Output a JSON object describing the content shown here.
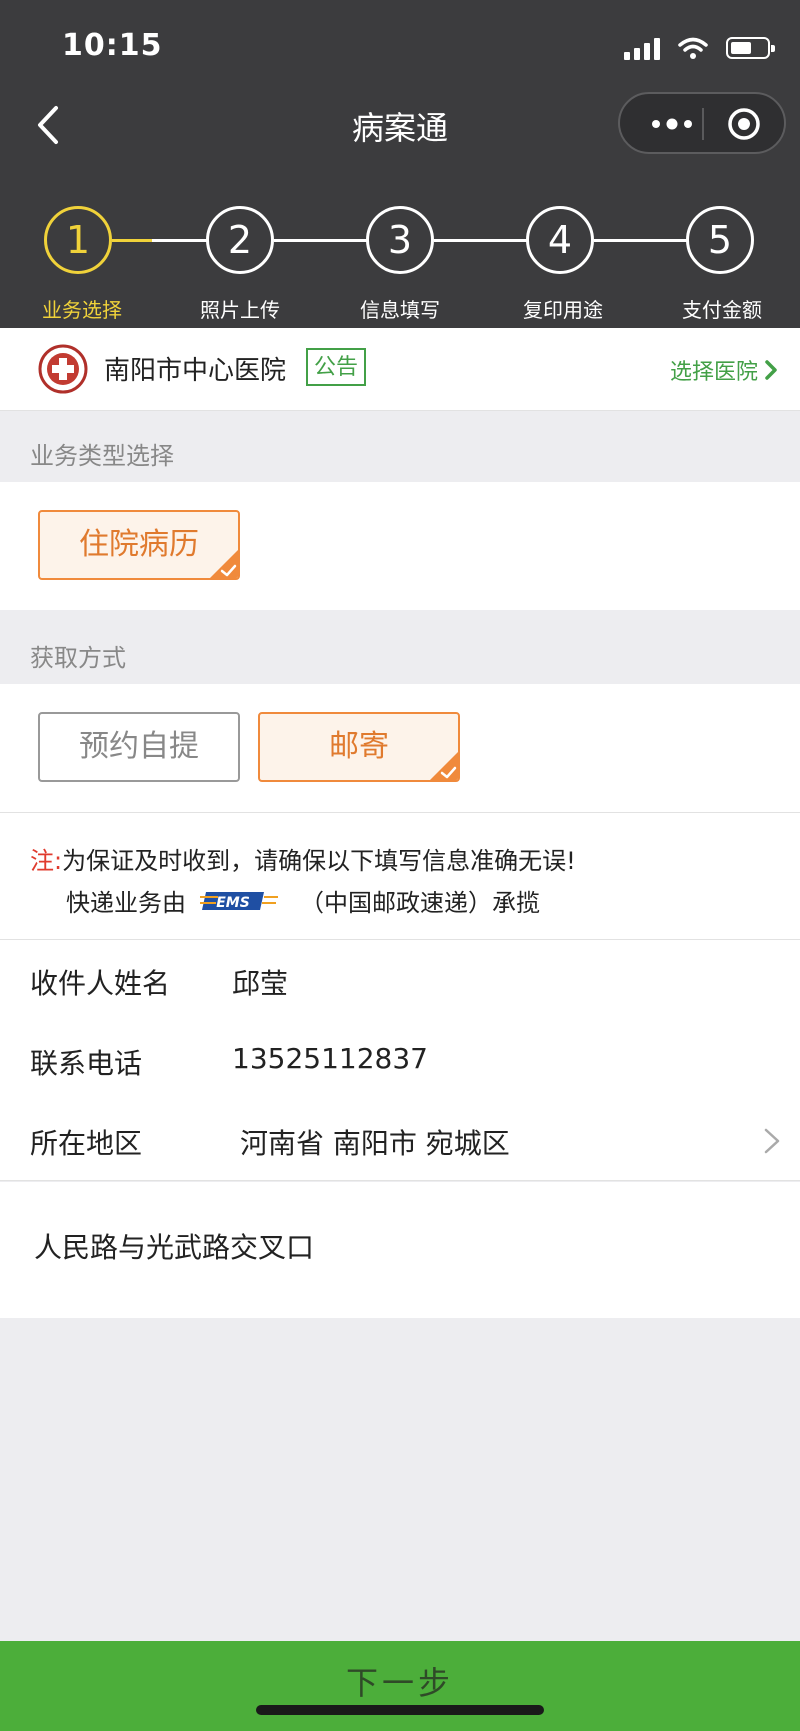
{
  "status_bar": {
    "time": "10:15"
  },
  "nav": {
    "title": "病案通"
  },
  "steps": [
    {
      "number": "1",
      "label": "业务选择",
      "active": true
    },
    {
      "number": "2",
      "label": "照片上传",
      "active": false
    },
    {
      "number": "3",
      "label": "信息填写",
      "active": false
    },
    {
      "number": "4",
      "label": "复印用途",
      "active": false
    },
    {
      "number": "5",
      "label": "支付金额",
      "active": false
    }
  ],
  "hospital": {
    "name": "南阳市中心医院",
    "notice_label": "公告",
    "choose_label": "选择医院"
  },
  "business_type": {
    "section_title": "业务类型选择",
    "options": [
      {
        "label": "住院病历",
        "selected": true
      }
    ]
  },
  "delivery": {
    "section_title": "获取方式",
    "options": [
      {
        "label": "预约自提",
        "selected": false
      },
      {
        "label": "邮寄",
        "selected": true
      }
    ]
  },
  "note": {
    "prefix": "注:",
    "line1": "为保证及时收到，请确保以下填写信息准确无误!",
    "line2_before": "快递业务由",
    "ems_logo_text": "EMS",
    "line2_after": "（中国邮政速递）承揽"
  },
  "form": {
    "recipient_label": "收件人姓名",
    "recipient_value": "邱莹",
    "phone_label": "联系电话",
    "phone_value": "13525112837",
    "region_label": "所在地区",
    "region_value": "河南省 南阳市 宛城区",
    "address_value": "人民路与光武路交叉口"
  },
  "footer": {
    "next_label": "下一步"
  },
  "colors": {
    "header_bg": "#3c3c3e",
    "active_step": "#f0d23a",
    "brand_green": "#43a047",
    "selected_orange": "#f08a3c",
    "note_red": "#e03b2e",
    "next_button": "#4cae3a"
  }
}
